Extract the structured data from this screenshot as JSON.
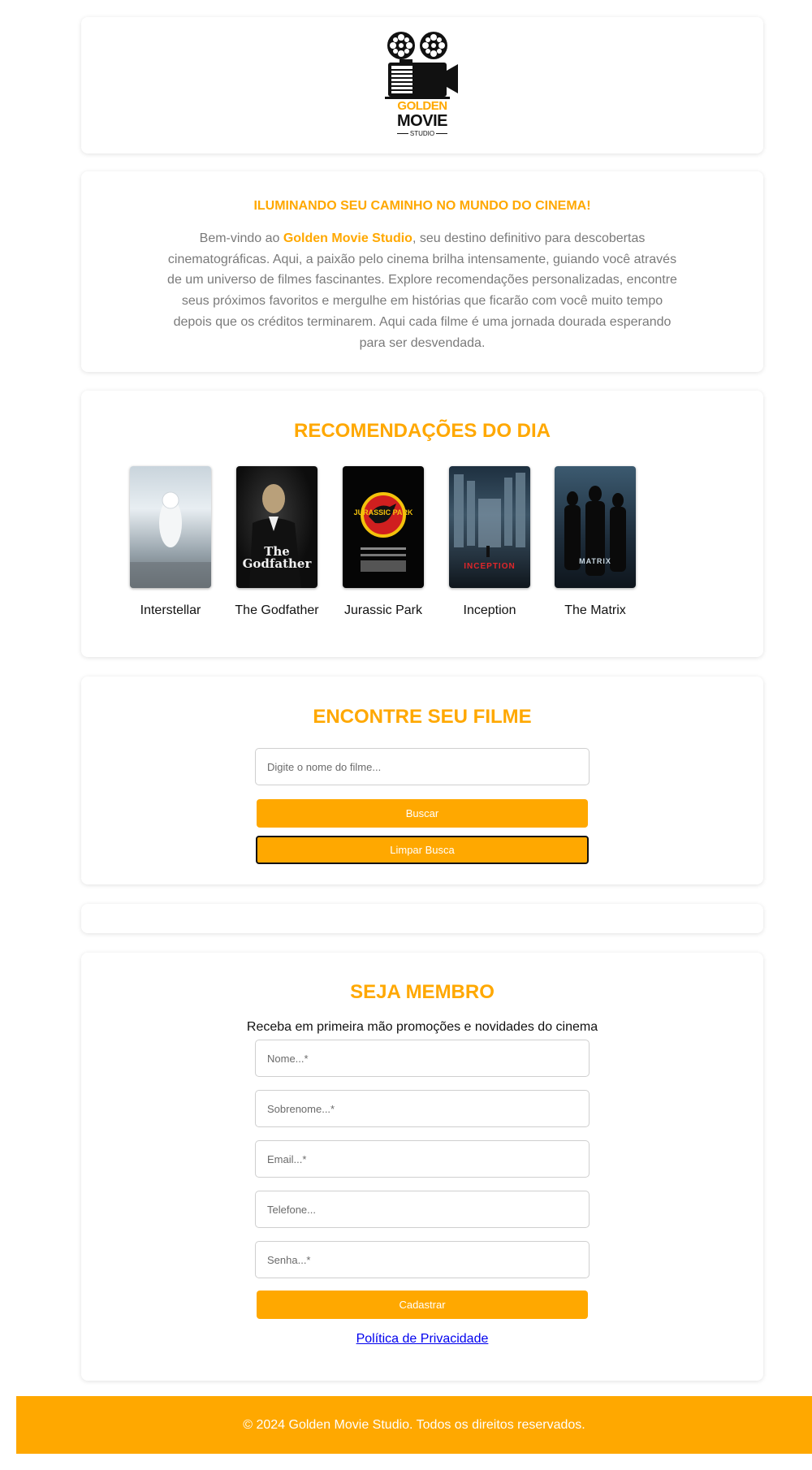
{
  "colors": {
    "accent": "#FFA800",
    "text_muted": "#7a7a7a",
    "link": "#0000EE"
  },
  "logo": {
    "line1": "GOLDEN",
    "line2": "MOVIE",
    "line3": "STUDIO"
  },
  "intro": {
    "heading": "ILUMINANDO SEU CAMINHO NO MUNDO DO CINEMA!",
    "text_before": "Bem-vindo ao ",
    "brand": "Golden Movie Studio",
    "text_after": ", seu destino definitivo para descobertas cinematográficas. Aqui, a paixão pelo cinema brilha intensamente, guiando você através de um universo de filmes fascinantes. Explore recomendações personalizadas, encontre seus próximos favoritos e mergulhe em histórias que ficarão com você muito tempo depois que os créditos terminarem. Aqui cada filme é uma jornada dourada esperando para ser desvendada."
  },
  "recommendations": {
    "title": "RECOMENDAÇÕES DO DIA",
    "movies": [
      {
        "title": "Interstellar"
      },
      {
        "title": "The Godfather",
        "poster_text": "The Godfather"
      },
      {
        "title": "Jurassic Park",
        "poster_text": "JURASSIC PARK"
      },
      {
        "title": "Inception",
        "poster_text": "INCEPTION"
      },
      {
        "title": "The Matrix",
        "poster_text": "MATRIX"
      }
    ]
  },
  "search": {
    "title": "ENCONTRE SEU FILME",
    "placeholder": "Digite o nome do filme...",
    "search_label": "Buscar",
    "clear_label": "Limpar Busca"
  },
  "member": {
    "title": "SEJA MEMBRO",
    "subtitle": "Receba em primeira mão promoções e novidades do cinema",
    "fields": {
      "first_name": "Nome...*",
      "last_name": "Sobrenome...*",
      "email": "Email...*",
      "phone": "Telefone...",
      "password": "Senha...*"
    },
    "submit_label": "Cadastrar",
    "privacy_label": "Política de Privacidade"
  },
  "footer": {
    "text": "© 2024 Golden Movie Studio. Todos os direitos reservados."
  }
}
